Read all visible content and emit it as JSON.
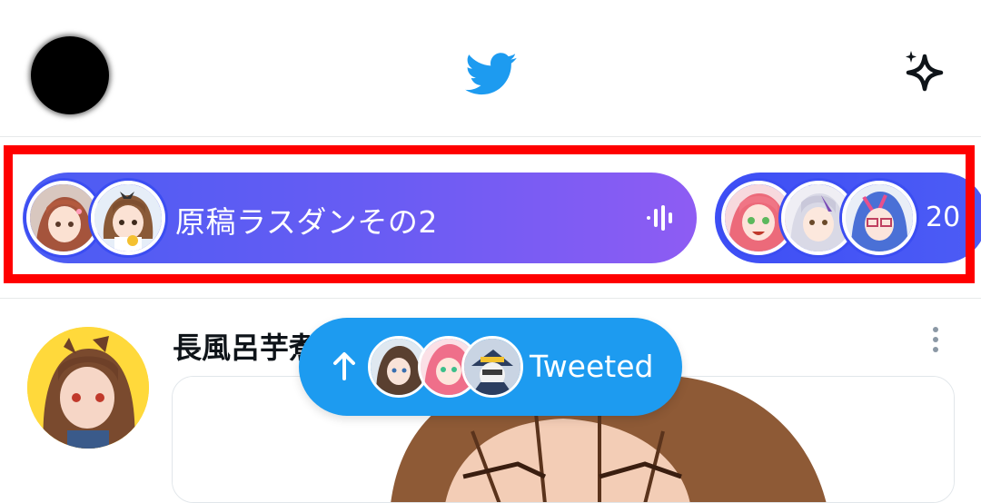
{
  "header": {
    "profile_avatar": "user-avatar",
    "logo_icon": "twitter-bird-icon",
    "right_icon": "sparkle-icon"
  },
  "spaces_bar": {
    "highlight_color": "#ff0000",
    "items": [
      {
        "title": "原稿ラスダンその2",
        "icon": "audio-waveform-icon",
        "avatars": [
          "host-avatar-1",
          "host-avatar-2"
        ]
      },
      {
        "title": "20",
        "avatars": [
          "host-avatar-1",
          "host-avatar-2",
          "host-avatar-3"
        ]
      }
    ]
  },
  "tweet": {
    "author": "長風呂芋煮",
    "more_icon": "more-vertical-icon"
  },
  "toast": {
    "label": "Tweeted",
    "icon": "arrow-up-icon",
    "avatars": [
      "avatar-1",
      "avatar-2",
      "avatar-3"
    ]
  },
  "colors": {
    "accent": "#1d9bf0",
    "space_gradient_start": "#4a5cf3",
    "space_gradient_end": "#8e5cf3"
  }
}
